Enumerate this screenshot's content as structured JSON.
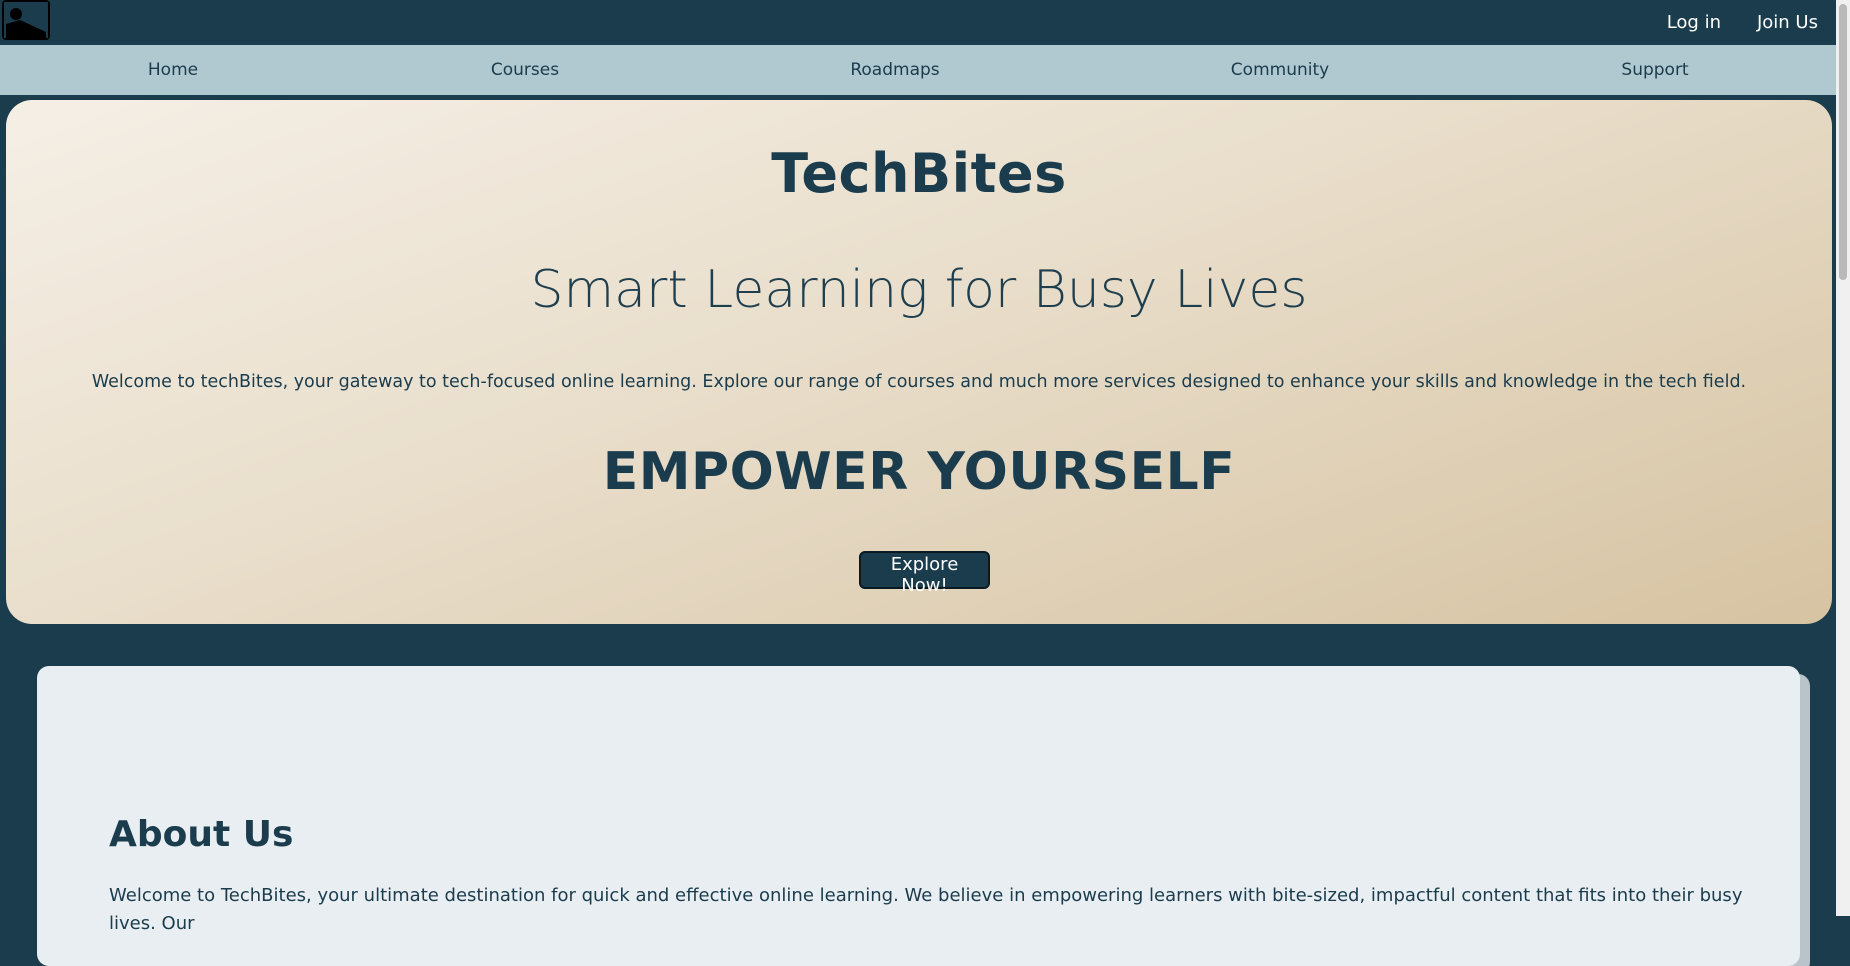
{
  "header": {
    "login_label": "Log in",
    "join_label": "Join Us"
  },
  "nav": {
    "items": [
      {
        "label": "Home"
      },
      {
        "label": "Courses"
      },
      {
        "label": "Roadmaps"
      },
      {
        "label": "Community"
      },
      {
        "label": "Support"
      }
    ]
  },
  "hero": {
    "title": "TechBites",
    "subtitle": "Smart Learning for Busy Lives",
    "description": "Welcome to techBites, your gateway to tech-focused online learning. Explore our range of courses and much more services designed to enhance your skills and knowledge in the tech field.",
    "tagline": "EMPOWER YOURSELF",
    "cta_label": "Explore Now!"
  },
  "about": {
    "heading": "About Us",
    "body": "Welcome to TechBites, your ultimate destination for quick and effective online learning. We believe in empowering learners with bite-sized, impactful content that fits into their busy lives. Our"
  },
  "colors": {
    "primary": "#1a3c4d",
    "nav_bg": "#b0c8d0",
    "hero_gradient_start": "#f5efe6",
    "hero_gradient_end": "#d6c3a2",
    "about_bg": "#e8eef1"
  }
}
